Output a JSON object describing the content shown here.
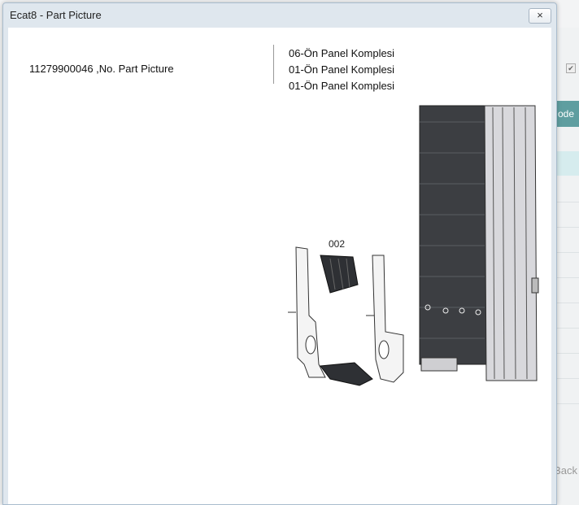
{
  "background": {
    "code_fragment": "ode",
    "back_fragment": "Back",
    "check_mark": "✔"
  },
  "dialog": {
    "title": "Ecat8 - Part Picture",
    "close_label": "×",
    "part_label": "11279900046 ,No. Part Picture",
    "groups": [
      "06-Ön Panel Komplesi",
      "01-Ön Panel Komplesi",
      "01-Ön Panel Komplesi"
    ],
    "drawing": {
      "callout": "002"
    }
  }
}
